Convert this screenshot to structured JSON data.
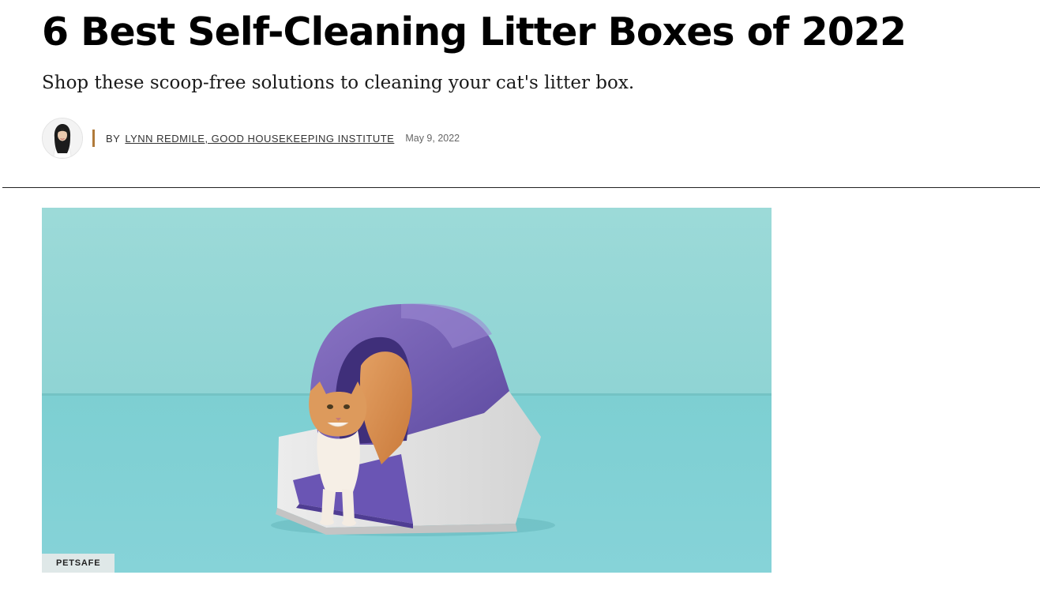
{
  "article": {
    "headline": "6 Best Self-Cleaning Litter Boxes of 2022",
    "dek": "Shop these scoop-free solutions to cleaning your cat's litter box."
  },
  "byline": {
    "prefix": "BY",
    "author": "LYNN REDMILE, GOOD HOUSEKEEPING INSTITUTE",
    "date": "May 9, 2022",
    "accent_color": "#b07a3a"
  },
  "hero": {
    "credit": "PETSAFE",
    "background_color": "#8fd6d6",
    "icons": [
      "author-avatar-icon",
      "litter-box-cat-image"
    ]
  }
}
